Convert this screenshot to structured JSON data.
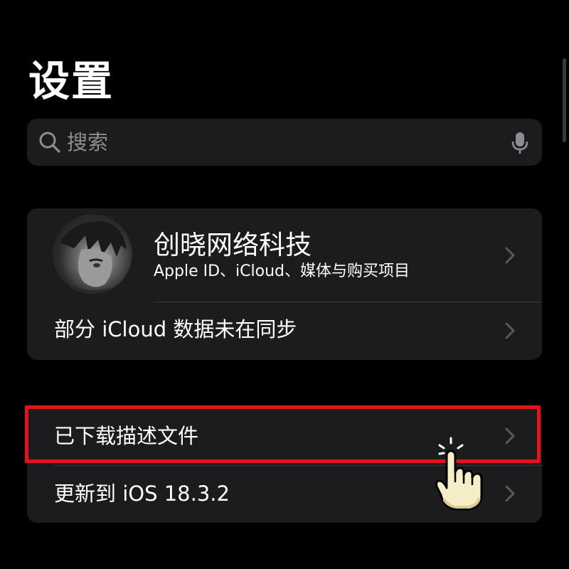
{
  "page": {
    "title": "设置"
  },
  "search": {
    "placeholder": "搜索"
  },
  "account": {
    "name": "创晓网络科技",
    "subtitle": "Apple ID、iCloud、媒体与购买项目"
  },
  "icloud_sync": {
    "label": "部分 iCloud 数据未在同步"
  },
  "profiles": {
    "label": "已下载描述文件"
  },
  "update": {
    "label": "更新到 iOS 18.3.2"
  },
  "annotations": {
    "highlight_color": "#e4121c"
  },
  "colors": {
    "background": "#000000",
    "cell": "#1c1c1e",
    "secondary_text": "#8d8d93",
    "chevron": "#5a5a5e"
  }
}
